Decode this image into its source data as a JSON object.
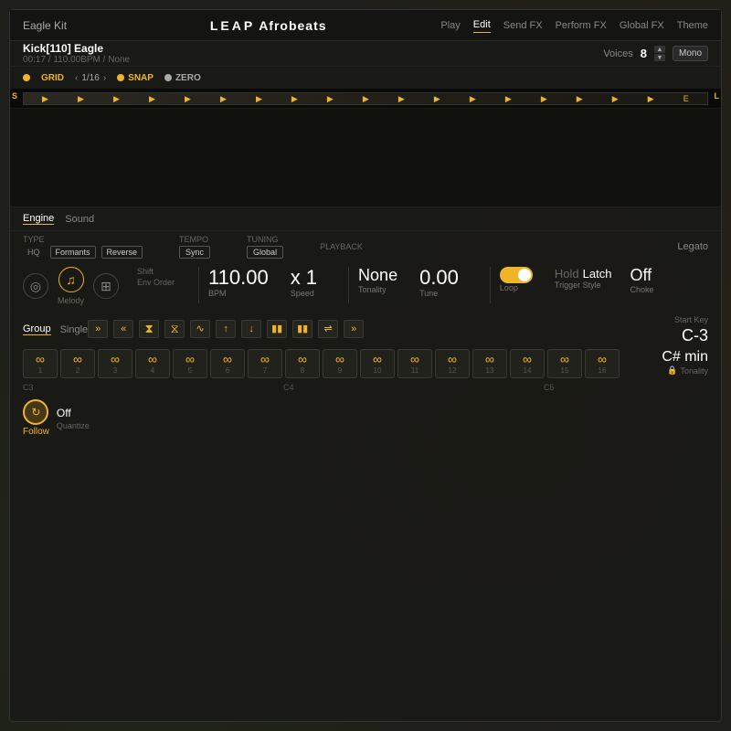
{
  "app": {
    "kit_name": "Eagle Kit",
    "title_leap": "LEAP",
    "title_preset": "Afrobeats",
    "nav_tabs": [
      "Play",
      "Edit",
      "Send FX",
      "Perform FX",
      "Global FX",
      "Theme"
    ],
    "active_nav": "Edit"
  },
  "track": {
    "name": "Kick[110] Eagle",
    "meta": "00:17 / 110.00BPM / None",
    "voices_label": "Voices",
    "voices_num": "8",
    "mode": "Mono"
  },
  "grid": {
    "label": "GRID",
    "value": "1/16",
    "snap_label": "SNAP",
    "zero_label": "ZERO"
  },
  "engine": {
    "tabs": [
      "Engine",
      "Sound"
    ],
    "active_tab": "Engine",
    "type_label": "TYPE",
    "hq_label": "HQ",
    "formants_label": "Formants",
    "reverse_label": "Reverse",
    "tempo_label": "TEMPO",
    "sync_label": "Sync",
    "bpm_val": "110.00",
    "bpm_unit": "BPM",
    "speed_val": "x 1",
    "speed_unit": "Speed",
    "tuning_label": "TUNING",
    "global_label": "Global",
    "tonality_val": "None",
    "tonality_unit": "Tonality",
    "tune_val": "0.00",
    "tune_unit": "Tune",
    "playback_label": "PLAYBACK",
    "legato_label": "Legato",
    "loop_label": "Loop",
    "hold_label": "Hold",
    "latch_label": "Latch",
    "trigger_style_label": "Trigger Style",
    "choke_label": "Choke",
    "off_label": "Off",
    "type_icons": [
      {
        "id": "circle",
        "symbol": "◎",
        "label": ""
      },
      {
        "id": "melody",
        "symbol": "♪",
        "label": "Melody"
      },
      {
        "id": "grid",
        "symbol": "⊞",
        "label": ""
      }
    ],
    "sub_labels": [
      "Shift",
      "Env Order"
    ]
  },
  "group": {
    "tabs": [
      "Group",
      "Single"
    ],
    "active_tab": "Group",
    "controls": [
      "»",
      "«",
      "⧉",
      "⧉",
      "∿",
      "↑",
      "↓",
      "▮▮",
      "▮▮",
      "⇌",
      "»"
    ],
    "start_key_label": "Start Key",
    "start_key_val": "C-3",
    "tonality_val": "C# min",
    "tonality_label": "Tonality"
  },
  "pads": [
    {
      "num": "1",
      "note": "",
      "octave": "C3"
    },
    {
      "num": "2",
      "note": ""
    },
    {
      "num": "3",
      "note": ""
    },
    {
      "num": "4",
      "note": ""
    },
    {
      "num": "5",
      "note": ""
    },
    {
      "num": "6",
      "note": ""
    },
    {
      "num": "7",
      "note": ""
    },
    {
      "num": "8",
      "note": ""
    },
    {
      "num": "9",
      "note": "",
      "octave": "C4"
    },
    {
      "num": "10",
      "note": ""
    },
    {
      "num": "11",
      "note": ""
    },
    {
      "num": "12",
      "note": ""
    },
    {
      "num": "13",
      "note": ""
    },
    {
      "num": "14",
      "note": ""
    },
    {
      "num": "15",
      "note": ""
    },
    {
      "num": "16",
      "note": "",
      "octave": "C5"
    }
  ],
  "follow": {
    "label": "Follow",
    "quantize_val": "Off",
    "quantize_label": "Quantize"
  },
  "colors": {
    "gold": "#f0b429",
    "bg_dark": "#1a1a16",
    "text_dim": "#666666",
    "panel_bg": "#1e1e1a"
  }
}
